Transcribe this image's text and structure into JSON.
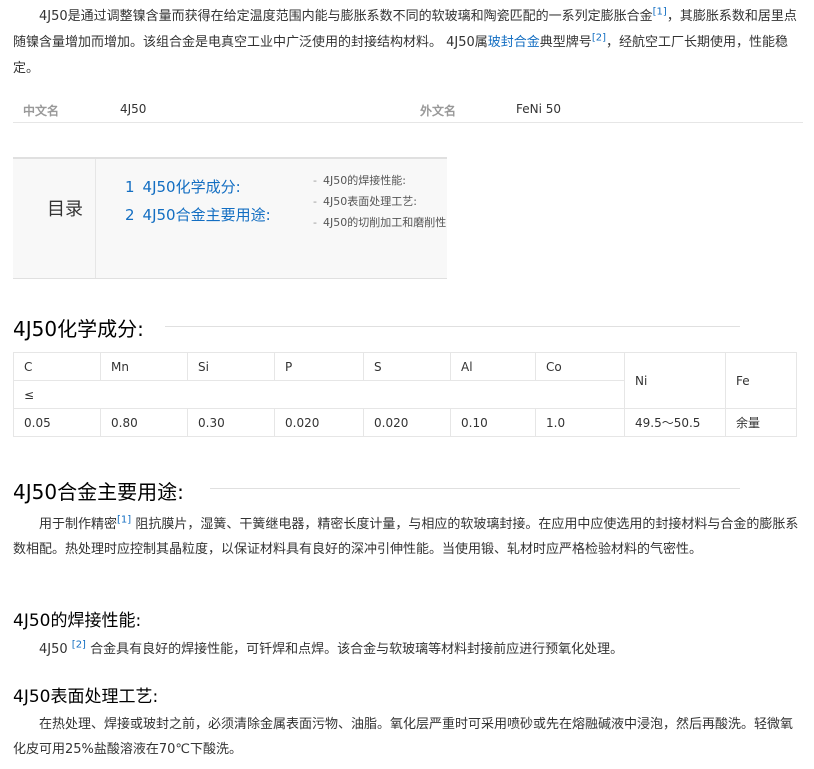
{
  "intro": {
    "p1_a": "4J50是通过调整镍含量而获得在给定温度范围内能与膨胀系数不同的软玻璃和陶瓷匹配的一系列定膨胀合金",
    "ref1": "[1]",
    "p1_b": "，其膨胀系数和居里点随镍含量增加而增加。该组合金是电真空工业中广泛使用的封接结构材料。 4J50属",
    "link": "玻封合金",
    "p1_c": "典型牌号",
    "ref2": "[2]",
    "p1_d": "，经航空工厂长期使用，性能稳定。"
  },
  "basic_info": {
    "label1": "中文名",
    "value1": "4J50",
    "label2": "外文名",
    "value2": "FeNi 50"
  },
  "toc": {
    "title": "目录",
    "items": [
      {
        "num": "1",
        "label": "4J50化学成分:"
      },
      {
        "num": "2",
        "label": "4J50合金主要用途:"
      }
    ],
    "subitems": [
      "4J50的焊接性能:",
      "4J50表面处理工艺:",
      "4J50的切削加工和磨削性"
    ],
    "dash": "-"
  },
  "section1": {
    "title": "4J50化学成分:",
    "table": {
      "headers": [
        "C",
        "Mn",
        "Si",
        "P",
        "S",
        "Al",
        "Co",
        "Ni",
        "Fe"
      ],
      "cond": "≤",
      "values": [
        "0.05",
        "0.80",
        "0.30",
        "0.020",
        "0.020",
        "0.10",
        "1.0",
        "49.5～50.5",
        "余量"
      ]
    }
  },
  "section2": {
    "title": "4J50合金主要用途:",
    "text_a": "用于制作精密",
    "ref": "[1]",
    "text_b": "阻抗膜片，湿簧、干簧继电器，精密长度计量，与相应的软玻璃封接。在应用中应使选用的封接材料与合金的膨胀系数相配。热处理时应控制其晶粒度，以保证材料具有良好的深冲引伸性能。当使用锻、轧材时应严格检验材料的气密性。"
  },
  "section3": {
    "title": "4J50的焊接性能:",
    "text_a": "4J50",
    "ref": "[2]",
    "text_b": "合金具有良好的焊接性能，可钎焊和点焊。该合金与软玻璃等材料封接前应进行预氧化处理。"
  },
  "section4": {
    "title": "4J50表面处理工艺:",
    "text": "在热处理、焊接或玻封之前，必须清除金属表面污物、油脂。氧化层严重时可采用喷砂或先在熔融碱液中浸泡，然后再酸洗。轻微氧化皮可用25%盐酸溶液在70℃下酸洗。"
  }
}
